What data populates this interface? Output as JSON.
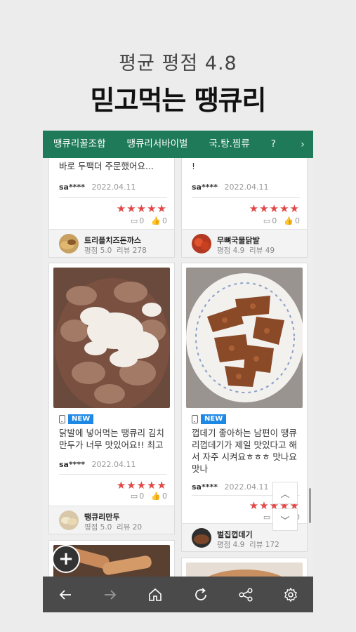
{
  "header": {
    "subtitle": "평균 평점 4.8",
    "title": "믿고먹는 땡큐리"
  },
  "tabs": [
    "땡큐리꿀조합",
    "땡큐리서바이벌",
    "국.탕.찜류",
    "?"
  ],
  "cards": [
    {
      "text": "바로 두팩더 주문했어요...",
      "user": "sa****",
      "date": "2022.04.11",
      "stars": "★★★★★",
      "comments": "0",
      "likes": "0",
      "shop": {
        "name": "트리플치즈돈까스",
        "rating": "평점 5.0",
        "reviews": "리뷰 278"
      }
    },
    {
      "text": "!",
      "user": "sa****",
      "date": "2022.04.11",
      "stars": "★★★★★",
      "comments": "0",
      "likes": "0",
      "shop": {
        "name": "무뼈국물닭발",
        "rating": "평점 4.9",
        "reviews": "리뷰 49"
      }
    },
    {
      "badge": "NEW",
      "text": "닭발에 넣어먹는 땡큐리 김치\n만두가 너무 맛있어요!! 최고",
      "user": "sa****",
      "date": "2022.04.11",
      "stars": "★★★★★",
      "comments": "0",
      "likes": "0",
      "shop": {
        "name": "땡큐리만두",
        "rating": "평점 5.0",
        "reviews": "리뷰 20"
      }
    },
    {
      "badge": "NEW",
      "text": "껍데기 좋아하는 남편이 땡큐\n리껍데기가 제일 맛있다고 해\n서 자주 시켜요ㅎㅎㅎ 맛나요\n맛나",
      "user": "sa****",
      "date": "2022.04.11",
      "stars": "★★★★★",
      "comments": "0",
      "likes": "0",
      "shop": {
        "name": "벌집껍데기",
        "rating": "평점 4.9",
        "reviews": "리뷰 172"
      }
    }
  ],
  "icons": {
    "fab": "plus-icon",
    "up": "chevron-up-icon",
    "down": "chevron-down-icon",
    "nav": [
      "back-arrow-icon",
      "forward-arrow-icon",
      "home-icon",
      "refresh-icon",
      "share-icon",
      "settings-icon"
    ]
  },
  "colors": {
    "brand": "#1f7a5a",
    "star": "#e04848",
    "badge": "#1e88e5",
    "navbar": "#4a4a4a"
  }
}
